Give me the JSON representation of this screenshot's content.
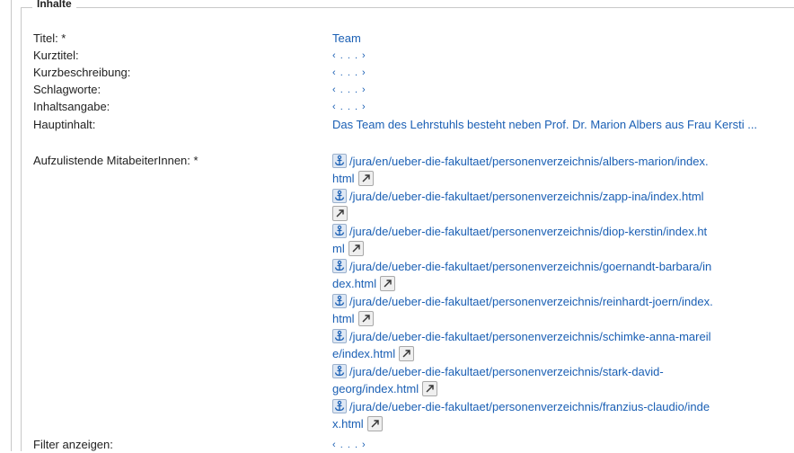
{
  "section": {
    "legend": "Inhalte"
  },
  "fields": {
    "titel": {
      "label": "Titel: *",
      "value": "Team"
    },
    "kurztitel": {
      "label": "Kurztitel:",
      "value": "‹ . . . ›"
    },
    "kurzbeschreibung": {
      "label": "Kurzbeschreibung:",
      "value": "‹ . . . ›"
    },
    "schlagworte": {
      "label": "Schlagworte:",
      "value": "‹ . . . ›"
    },
    "inhaltsangabe": {
      "label": "Inhaltsangabe:",
      "value": "‹ . . . ›"
    },
    "hauptinhalt": {
      "label": "Hauptinhalt:",
      "value": "Das Team des Lehrstuhls besteht neben Prof. Dr. Marion Albers aus Frau Kersti ..."
    },
    "mitarbeiter": {
      "label": "Aufzulistende MitabeiterInnen: *",
      "links": [
        {
          "line1": "/jura/en/ueber-die-fakultaet/personenverzeichnis/albers-marion/index.",
          "line2": "html"
        },
        {
          "line1": "/jura/de/ueber-die-fakultaet/personenverzeichnis/zapp-ina/index.html",
          "line2": ""
        },
        {
          "line1": "/jura/de/ueber-die-fakultaet/personenverzeichnis/diop-kerstin/index.ht",
          "line2": "ml"
        },
        {
          "line1": "/jura/de/ueber-die-fakultaet/personenverzeichnis/goernandt-barbara/in",
          "line2": "dex.html"
        },
        {
          "line1": "/jura/de/ueber-die-fakultaet/personenverzeichnis/reinhardt-joern/index.",
          "line2": "html"
        },
        {
          "line1": "/jura/de/ueber-die-fakultaet/personenverzeichnis/schimke-anna-mareil",
          "line2": "e/index.html"
        },
        {
          "line1": "/jura/de/ueber-die-fakultaet/personenverzeichnis/stark-david-",
          "line2": "georg/index.html"
        },
        {
          "line1": "/jura/de/ueber-die-fakultaet/personenverzeichnis/franzius-claudio/inde",
          "line2": "x.html"
        }
      ]
    },
    "filter": {
      "label": "Filter anzeigen:",
      "value": "‹ . . . ›"
    }
  },
  "icons": {
    "anchor": "anchor-icon",
    "external": "external-link-icon"
  },
  "colors": {
    "link": "#1a5fb4",
    "border": "#c8c8c8"
  }
}
